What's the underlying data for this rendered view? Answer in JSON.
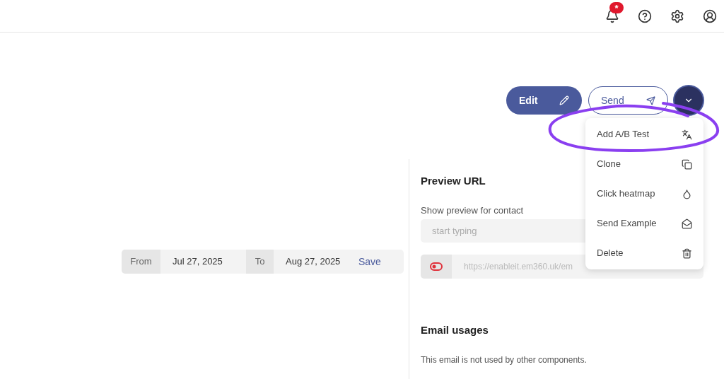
{
  "header": {
    "notification_badge": "*"
  },
  "actions": {
    "edit": "Edit",
    "send": "Send"
  },
  "menu": {
    "items": [
      {
        "label": "Add A/B Test",
        "kind": "ab"
      },
      {
        "label": "Clone",
        "kind": "clone"
      },
      {
        "label": "Click heatmap",
        "kind": "heatmap"
      },
      {
        "label": "Send Example",
        "kind": "send"
      },
      {
        "label": "Delete",
        "kind": "delete"
      }
    ]
  },
  "date_range": {
    "from_label": "From",
    "from": "Jul 27, 2025",
    "to_label": "To",
    "to": "Aug 27, 2025",
    "save": "Save"
  },
  "preview": {
    "title": "Preview URL",
    "contact_label": "Show preview for contact",
    "contact_placeholder": "start typing",
    "url_enabled": false,
    "url": "https://enableit.em360.uk/em"
  },
  "usages": {
    "title": "Email usages",
    "text": "This email is not used by other components."
  }
}
